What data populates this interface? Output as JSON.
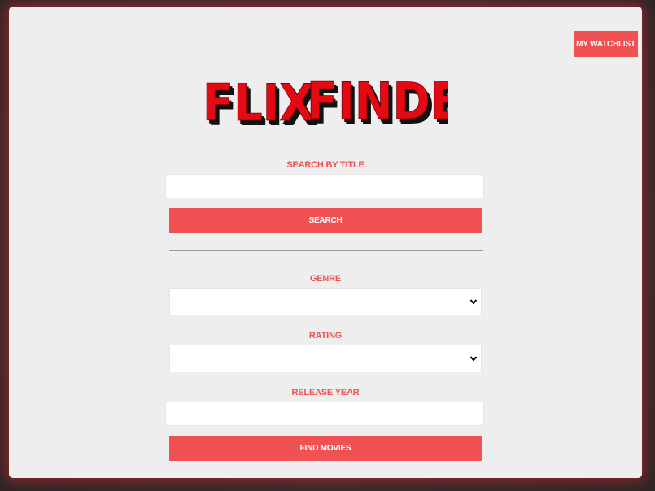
{
  "header": {
    "watchlist_label": "My Watchlist"
  },
  "logo": {
    "text": "FLIX FINDER",
    "word1": "FLIX",
    "word2": "FINDER"
  },
  "search": {
    "title_label": "Search by Title",
    "title_value": "",
    "button_label": "Search"
  },
  "filters": {
    "genre_label": "Genre",
    "genre_value": "",
    "rating_label": "Rating",
    "rating_value": "",
    "year_label": "Release Year",
    "year_value": "",
    "button_label": "Find Movies"
  },
  "colors": {
    "accent": "#f05254",
    "logo_red": "#e50914",
    "card_bg": "#eeeeee"
  }
}
